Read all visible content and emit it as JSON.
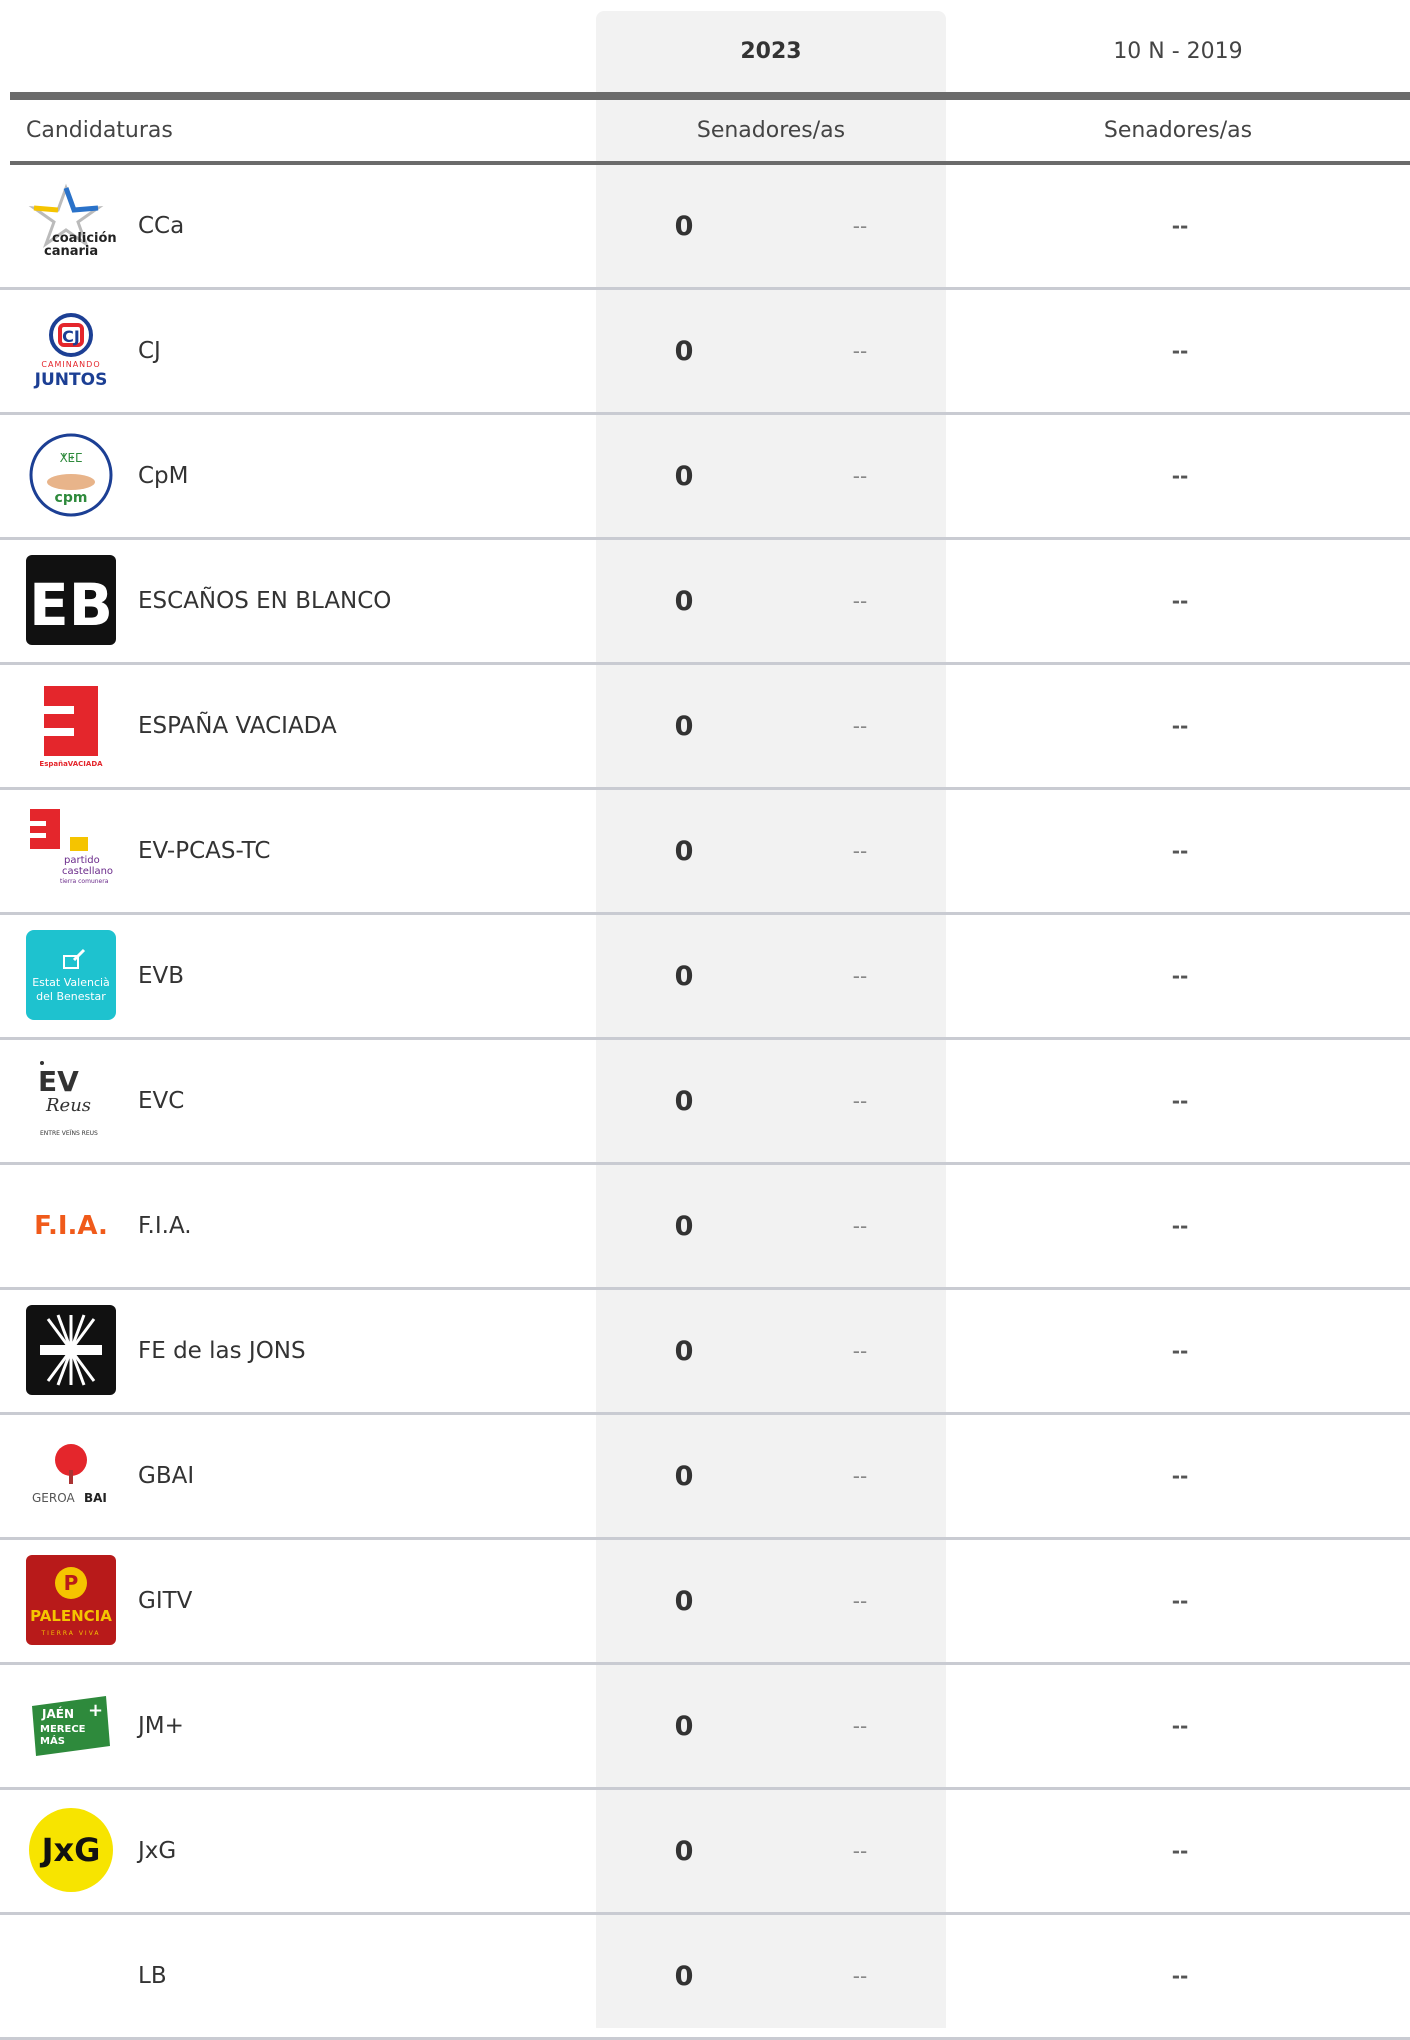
{
  "header": {
    "current_year": "2023",
    "previous_year": "10 N - 2019",
    "candidaturas_label": "Candidaturas",
    "current_sub": "Senadores/as",
    "previous_sub": "Senadores/as"
  },
  "rows": [
    {
      "name": "CCa",
      "seats": "0",
      "diff": "--",
      "prev": "--",
      "logo": "coalicion-canaria-logo",
      "logo_text": [
        "coalición",
        "canaria"
      ]
    },
    {
      "name": "CJ",
      "seats": "0",
      "diff": "--",
      "prev": "--",
      "logo": "caminando-juntos-logo",
      "logo_text": [
        "CAMINANDO",
        "JUNTOS"
      ]
    },
    {
      "name": "CpM",
      "seats": "0",
      "diff": "--",
      "prev": "--",
      "logo": "cpm-logo",
      "logo_text": [
        "cpm"
      ]
    },
    {
      "name": "ESCAÑOS EN BLANCO",
      "seats": "0",
      "diff": "--",
      "prev": "--",
      "logo": "escanos-en-blanco-logo",
      "logo_text": [
        "EB"
      ]
    },
    {
      "name": "ESPAÑA VACIADA",
      "seats": "0",
      "diff": "--",
      "prev": "--",
      "logo": "espana-vaciada-logo",
      "logo_text": [
        "EspañaVACIADA"
      ]
    },
    {
      "name": "EV-PCAS-TC",
      "seats": "0",
      "diff": "--",
      "prev": "--",
      "logo": "ev-pcas-tc-logo",
      "logo_text": [
        "partido",
        "castellano",
        "tierra comunera"
      ]
    },
    {
      "name": "EVB",
      "seats": "0",
      "diff": "--",
      "prev": "--",
      "logo": "evb-logo",
      "logo_text": [
        "Estat Valencià",
        "del Benestar"
      ]
    },
    {
      "name": "EVC",
      "seats": "0",
      "diff": "--",
      "prev": "--",
      "logo": "evc-logo",
      "logo_text": [
        "EV",
        "Reus",
        "ENTRE VEÏNS REUS"
      ]
    },
    {
      "name": "F.I.A.",
      "seats": "0",
      "diff": "--",
      "prev": "--",
      "logo": "fia-logo",
      "logo_text": [
        "F.I.A."
      ]
    },
    {
      "name": "FE de las JONS",
      "seats": "0",
      "diff": "--",
      "prev": "--",
      "logo": "fe-jons-logo",
      "logo_text": []
    },
    {
      "name": "GBAI",
      "seats": "0",
      "diff": "--",
      "prev": "--",
      "logo": "geroa-bai-logo",
      "logo_text": [
        "GEROA",
        "BAI"
      ]
    },
    {
      "name": "GITV",
      "seats": "0",
      "diff": "--",
      "prev": "--",
      "logo": "gitv-logo",
      "logo_text": [
        "PALENCIA",
        "TIERRA VIVA"
      ]
    },
    {
      "name": "JM+",
      "seats": "0",
      "diff": "--",
      "prev": "--",
      "logo": "jaen-merece-mas-logo",
      "logo_text": [
        "JAÉN",
        "MERECE",
        "MÁS"
      ]
    },
    {
      "name": "JxG",
      "seats": "0",
      "diff": "--",
      "prev": "--",
      "logo": "jxg-logo",
      "logo_text": [
        "JxG"
      ]
    },
    {
      "name": "LB",
      "seats": "0",
      "diff": "--",
      "prev": "--",
      "logo": "",
      "logo_text": []
    }
  ],
  "colors": {
    "column_highlight": "#f2f2f2",
    "rule": "#6b6b6b",
    "row_divider": "#c9cbd2",
    "evb_teal": "#1ec2cf",
    "espana_vaciada_red": "#e4262c",
    "fia_orange": "#f05a1a",
    "jxg_yellow": "#f7e400",
    "juntos_blue": "#1c3f94",
    "gitv_red": "#b81a1a",
    "jm_green": "#2e8a3c"
  }
}
